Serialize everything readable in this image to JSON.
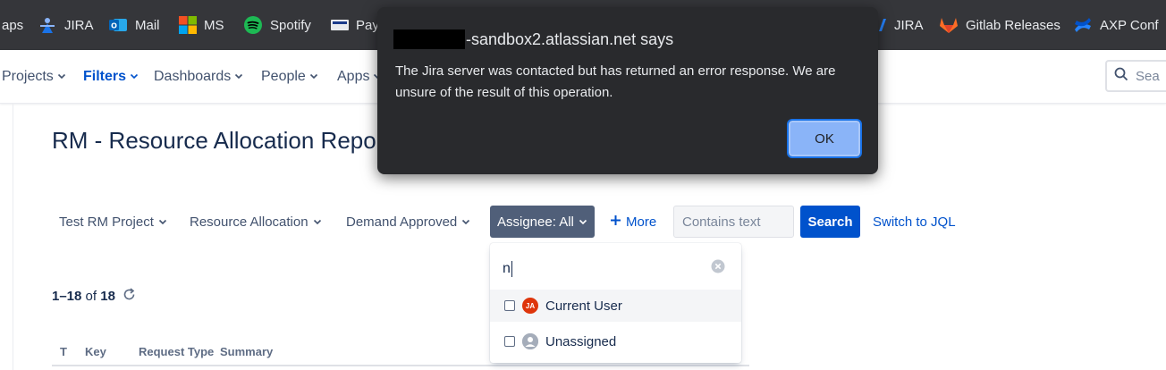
{
  "bookmarks": [
    {
      "label": "aps",
      "icon": "apps-icon"
    },
    {
      "label": "JIRA",
      "icon": "jira-icon"
    },
    {
      "label": "Mail",
      "icon": "outlook-icon"
    },
    {
      "label": "MS",
      "icon": "microsoft-icon"
    },
    {
      "label": "Spotify",
      "icon": "spotify-icon"
    },
    {
      "label": "Pay",
      "icon": "pay-icon"
    },
    {
      "label": "JIRA",
      "icon": "jira-icon"
    },
    {
      "label": "Gitlab Releases",
      "icon": "gitlab-icon"
    },
    {
      "label": "AXP Conf",
      "icon": "confluence-icon"
    }
  ],
  "nav": {
    "projects": "Projects",
    "filters": "Filters",
    "dashboards": "Dashboards",
    "people": "People",
    "apps": "Apps",
    "search_placeholder": "Sea"
  },
  "page": {
    "title": "RM - Resource Allocation Repo"
  },
  "filters": {
    "project": "Test RM Project",
    "type": "Resource Allocation",
    "status": "Demand Approved",
    "assignee": "Assignee: All",
    "more": "More",
    "contains_placeholder": "Contains text",
    "search": "Search",
    "switch_jql": "Switch to JQL"
  },
  "results": {
    "range": "1–18",
    "of": "of",
    "total": "18"
  },
  "table": {
    "headers": [
      "T",
      "Key",
      "Request Type",
      "Summary"
    ]
  },
  "assignee_dropdown": {
    "query": "n",
    "options": [
      {
        "label": "Current User",
        "avatar": "JA"
      },
      {
        "label": "Unassigned",
        "avatar": ""
      }
    ]
  },
  "dialog": {
    "title_suffix": "-sandbox2.atlassian.net says",
    "message": "The Jira server was contacted but has returned an error response. We are unsure of the result of this operation.",
    "ok": "OK"
  },
  "colors": {
    "bookmark_bar": "#35363a",
    "jira_blue": "#0052cc",
    "dialog_bg": "#292a2d",
    "ok_button": "#8ab4f8"
  }
}
